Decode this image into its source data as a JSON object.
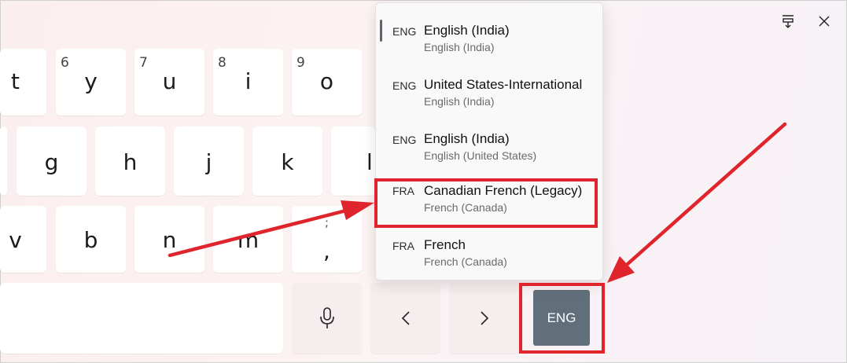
{
  "keyboard": {
    "row1": [
      {
        "main": "t",
        "num": ""
      },
      {
        "main": "y",
        "num": "6"
      },
      {
        "main": "u",
        "num": "7"
      },
      {
        "main": "i",
        "num": "8"
      },
      {
        "main": "o",
        "num": "9"
      }
    ],
    "row2": [
      {
        "main": "g"
      },
      {
        "main": "h"
      },
      {
        "main": "j"
      },
      {
        "main": "k"
      },
      {
        "main": "l"
      }
    ],
    "row3": [
      {
        "main": "v",
        "sec": ""
      },
      {
        "main": "b",
        "sec": ""
      },
      {
        "main": "n",
        "sec": ""
      },
      {
        "main": "m",
        "sec": ""
      },
      {
        "main": ",",
        "sec": ";"
      }
    ],
    "language_key_label": "ENG"
  },
  "icons": {
    "microphone": "microphone-icon",
    "previous": "chevron-left-icon",
    "next": "chevron-right-icon",
    "dock": "dock-icon",
    "close": "close-icon"
  },
  "language_menu": {
    "items": [
      {
        "code": "ENG",
        "name": "English (India)",
        "subtitle": "English (India)",
        "selected": true
      },
      {
        "code": "ENG",
        "name": "United States-International",
        "subtitle": "English (India)",
        "selected": false
      },
      {
        "code": "ENG",
        "name": "English (India)",
        "subtitle": "English (United States)",
        "selected": false
      },
      {
        "code": "FRA",
        "name": "Canadian French (Legacy)",
        "subtitle": "French (Canada)",
        "selected": false
      },
      {
        "code": "FRA",
        "name": "French",
        "subtitle": "French (Canada)",
        "selected": false
      }
    ]
  },
  "annotation_color": "#e0242c"
}
